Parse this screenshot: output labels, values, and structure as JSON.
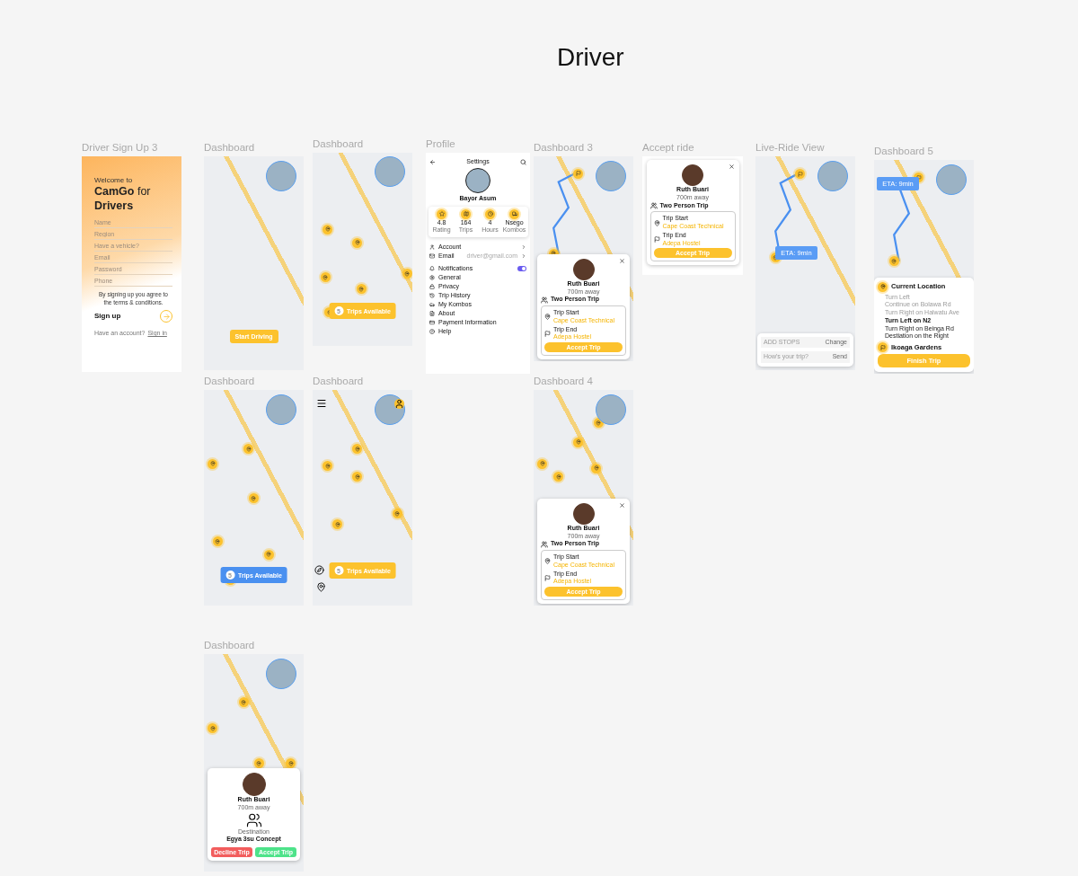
{
  "canvas_title": "Driver",
  "frames": [
    {
      "kind": "signup",
      "label": "Driver Sign Up 3",
      "greeting": "Welcome to",
      "headline": "**CamGo** for **Drivers**",
      "fields": [
        {
          "placeholder": "Name"
        },
        {
          "placeholder": "Region"
        },
        {
          "placeholder": "Have a vehicle?"
        },
        {
          "placeholder": "Email"
        },
        {
          "placeholder": "Password"
        },
        {
          "placeholder": "Phone"
        }
      ],
      "terms": "By signing up you agree to the terms & conditions.",
      "submit": "Sign up",
      "footer": "Have an account?",
      "link": "Sign in"
    },
    {
      "kind": "map",
      "label": "Dashboard",
      "button": {
        "label": "Start Driving",
        "color": "#fcc22d"
      }
    },
    {
      "kind": "map",
      "label": "Dashboard",
      "trips": {
        "count": "5",
        "label": "Trips Available",
        "color": "#fcc22d"
      }
    },
    {
      "kind": "profile",
      "label": "Profile",
      "header": "Settings",
      "name": "Bayor Asum",
      "stats": [
        {
          "value": "4.8",
          "label": "Rating"
        },
        {
          "value": "164",
          "label": "Trips"
        },
        {
          "value": "4",
          "label": "Hours"
        },
        {
          "value": "Nsego",
          "label": "Kombos"
        }
      ],
      "menu": [
        {
          "label": "Account",
          "chevron": true
        },
        {
          "label": "Email",
          "value": "driver@gmail.com",
          "chevron": true
        },
        {
          "label": "Notifications",
          "toggle": true,
          "on": true
        },
        {
          "label": "General"
        },
        {
          "label": "Privacy"
        },
        {
          "label": "Trip History"
        },
        {
          "label": "My Kombos"
        },
        {
          "label": "About"
        },
        {
          "label": "Payment Information"
        },
        {
          "label": "Help"
        }
      ]
    },
    {
      "kind": "map",
      "label": "Dashboard 3",
      "route": true,
      "card": {
        "name": "Ruth Buari",
        "distance": "700m away",
        "trip_type": "Two Person Trip",
        "start_label": "Trip Start",
        "start": "Cape Coast Technical",
        "end_label": "Trip End",
        "end": "Adepa Hostel",
        "action": "Accept Trip"
      }
    },
    {
      "kind": "card_only",
      "label": "Accept ride",
      "card": {
        "name": "Ruth Buari",
        "distance": "700m away",
        "trip_type": "Two Person Trip",
        "start_label": "Trip Start",
        "start": "Cape Coast Technical",
        "end_label": "Trip End",
        "end": "Adepa Hostel",
        "action": "Accept Trip"
      }
    },
    {
      "kind": "map",
      "label": "Live-Ride View",
      "route": true,
      "eta": "ETA: 9min",
      "ride_panel": {
        "stops_placeholder": "ADD STOPS",
        "stops_action": "Change",
        "message_placeholder": "How's your trip?",
        "message_action": "Send"
      }
    },
    {
      "kind": "map",
      "label": "Dashboard 5",
      "route": true,
      "eta": "ETA: 9min",
      "directions": {
        "origin": "Current Location",
        "steps": [
          {
            "text": "Turn Left",
            "kind": "done"
          },
          {
            "text": "Continue on Bolawa Rd",
            "kind": "done"
          },
          {
            "text": "Turn Right on Halwatu Ave",
            "kind": "done"
          },
          {
            "text": "Turn Left on N2",
            "kind": "current"
          },
          {
            "text": "Turn Right on Beinga Rd",
            "kind": "next"
          },
          {
            "text": "Destiation on the Right",
            "kind": "next"
          }
        ],
        "destination": "Ikoaga Gardens",
        "action": "Finish Trip"
      }
    },
    {
      "kind": "map",
      "label": "Dashboard",
      "trips": {
        "count": "5",
        "label": "Trips Available",
        "color": "#4a90f0"
      }
    },
    {
      "kind": "map",
      "label": "Dashboard",
      "map_controls": true,
      "trips": {
        "count": "5",
        "label": "Trips Available",
        "color": "#fcc22d"
      }
    },
    {
      "kind": "map",
      "label": "Dashboard 4",
      "card": {
        "name": "Ruth Buari",
        "distance": "700m away",
        "trip_type": "Two Person Trip",
        "start_label": "Trip Start",
        "start": "Cape Coast Technical",
        "end_label": "Trip End",
        "end": "Adepa Hostel",
        "action": "Accept Trip"
      }
    },
    {
      "kind": "map",
      "label": "Dashboard",
      "request": {
        "name": "Ruth Buari",
        "distance": "700m away",
        "dest_label": "Destination",
        "destination": "Egya 3su Concept",
        "decline": "Decline Trip",
        "accept": "Accept Trip"
      }
    }
  ]
}
